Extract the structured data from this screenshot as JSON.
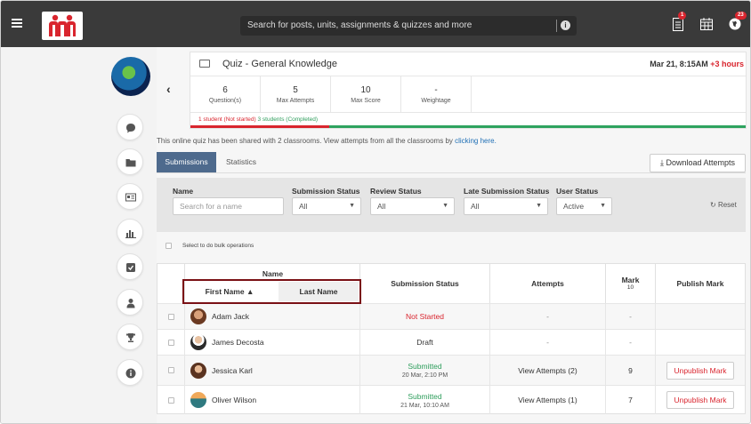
{
  "topbar": {
    "search_placeholder": "Search for posts, units, assignments & quizzes and more",
    "badges": {
      "doc": "1",
      "globe": "23"
    }
  },
  "quiz": {
    "title": "Quiz - General Knowledge",
    "date": "Mar 21, 8:15AM",
    "date_extra": "+3 hours",
    "stats": [
      {
        "value": "6",
        "label": "Question(s)"
      },
      {
        "value": "5",
        "label": "Max Attempts"
      },
      {
        "value": "10",
        "label": "Max Score"
      },
      {
        "value": "-",
        "label": "Weightage"
      }
    ],
    "progress_not_started": "1 student (Not started)",
    "progress_completed": "3 students (Completed)",
    "progress_fraction_not_started": 0.25
  },
  "shared_text": "This online quiz has been shared with 2 classrooms. View attempts from all the classrooms by",
  "shared_link": "clicking here.",
  "tabs": {
    "submissions": "Submissions",
    "statistics": "Statistics"
  },
  "download_label": "Download Attempts",
  "filters": {
    "name_label": "Name",
    "name_placeholder": "Search for a name",
    "submission_status_label": "Submission Status",
    "submission_status_value": "All",
    "review_status_label": "Review Status",
    "review_status_value": "All",
    "late_label": "Late Submission Status",
    "late_value": "All",
    "user_status_label": "User Status",
    "user_status_value": "Active",
    "reset_label": "Reset"
  },
  "bulk_label": "Select to do bulk operations",
  "table": {
    "name_header": "Name",
    "first_name": "First Name",
    "last_name": "Last Name",
    "submission_status": "Submission Status",
    "attempts": "Attempts",
    "mark": "Mark",
    "mark_max": "10",
    "publish_mark": "Publish Mark",
    "rows": [
      {
        "name": "Adam Jack",
        "status": "Not Started",
        "status_date": "",
        "attempts": "-",
        "mark": "-",
        "publish": ""
      },
      {
        "name": "James Decosta",
        "status": "Draft",
        "status_date": "",
        "attempts": "-",
        "mark": "-",
        "publish": ""
      },
      {
        "name": "Jessica Karl",
        "status": "Submitted",
        "status_date": "20 Mar, 2:10 PM",
        "attempts": "View Attempts (2)",
        "mark": "9",
        "publish": "Unpublish Mark"
      },
      {
        "name": "Oliver Wilson",
        "status": "Submitted",
        "status_date": "21 Mar, 10:10 AM",
        "attempts": "View Attempts (1)",
        "mark": "7",
        "publish": "Unpublish Mark"
      }
    ]
  }
}
